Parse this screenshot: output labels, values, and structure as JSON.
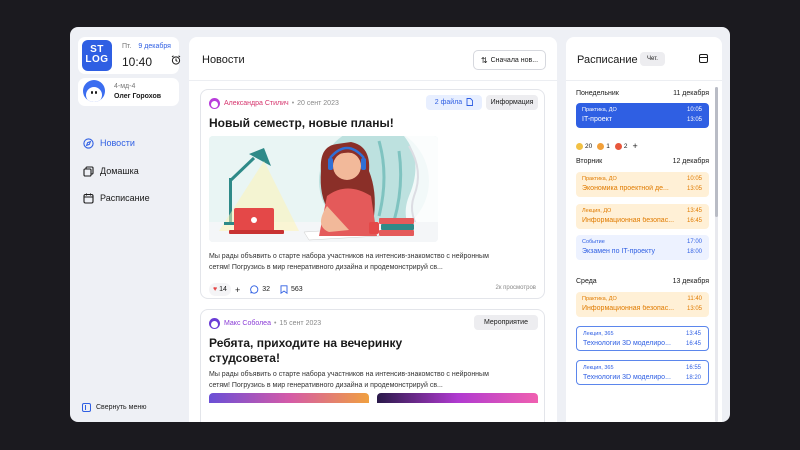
{
  "app": {
    "logo_line1": "ST",
    "logo_line2": "LOG",
    "weekday": "Пт.",
    "date": "9 декабря",
    "time": "10:40"
  },
  "user": {
    "group": "4-мд-4",
    "name": "Олег Горохов"
  },
  "nav": {
    "news": "Новости",
    "homework": "Домашка",
    "schedule": "Расписание",
    "collapse": "Свернуть меню"
  },
  "news": {
    "title": "Новости",
    "sort_label": "Сначала нов...",
    "posts": [
      {
        "author": "Александра Стилич",
        "date": "20 сент 2023",
        "files_label": "2 файла",
        "tag": "Информация",
        "title": "Новый семестр, новые планы!",
        "text": "Мы рады объявить о старте набора участников на интенсив-знакомство с нейронным сетям! Погрузись в мир генеративного дизайна и продемонстрируй св...",
        "likes": "14",
        "comments": "32",
        "saves": "563",
        "views": "2к просмотров"
      },
      {
        "author": "Макс Соболеа",
        "date": "15 сент 2023",
        "tag": "Мероприятие",
        "title_line1": "Ребята, приходите на вечеринку",
        "title_line2": "студсовета!",
        "text": "Мы рады объявить о старте набора участников на интенсив-знакомство с нейронным сетям! Погрузись в мир генеративного дизайна и продемонстрируй св..."
      }
    ]
  },
  "schedule": {
    "title": "Расписание",
    "week_label": "Чет.",
    "days": [
      {
        "name": "Понедельник",
        "date": "11 декабря",
        "events": [
          {
            "type": "Практика, ДО",
            "name": "IT-проект",
            "start": "10:05",
            "end": "13:05"
          }
        ],
        "reactions": [
          {
            "count": "20"
          },
          {
            "count": "1"
          },
          {
            "count": "2"
          }
        ]
      },
      {
        "name": "Вторник",
        "date": "12 декабря",
        "events": [
          {
            "type": "Практика, ДО",
            "name": "Экономика проектной де...",
            "start": "10:05",
            "end": "13:05"
          },
          {
            "type": "Лекция, ДО",
            "name": "Информационная безопас...",
            "start": "13:45",
            "end": "16:45"
          },
          {
            "type": "Событие",
            "name": "Экзамен по IT-проекту",
            "start": "17:00",
            "end": "18:00"
          }
        ]
      },
      {
        "name": "Среда",
        "date": "13 декабря",
        "events": [
          {
            "type": "Практика, ДО",
            "name": "Информационная безопас...",
            "start": "11:40",
            "end": "13:05"
          },
          {
            "type": "Лекция, 365",
            "name": "Технологии 3D моделиро...",
            "start": "13:45",
            "end": "16:45"
          },
          {
            "type": "Лекция, 365",
            "name": "Технологии 3D моделиро...",
            "start": "16:55",
            "end": "18:20"
          }
        ]
      }
    ]
  },
  "colors": {
    "accent": "#2f5fe3",
    "background": "#eef0f5",
    "event_orange": "#e07b00",
    "author_pink": "#d6336c"
  }
}
